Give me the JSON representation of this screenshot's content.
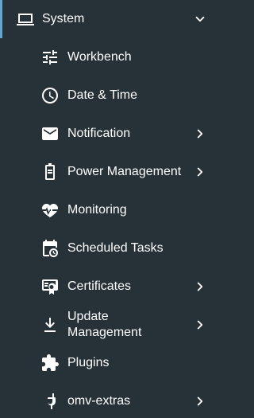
{
  "nav": {
    "system": {
      "label": "System",
      "icon": "laptop-icon",
      "expanded": true
    },
    "items": [
      {
        "label": "Workbench",
        "icon": "tune-icon",
        "has_submenu": false
      },
      {
        "label": "Date & Time",
        "icon": "clock-icon",
        "has_submenu": false
      },
      {
        "label": "Notification",
        "icon": "mail-icon",
        "has_submenu": true
      },
      {
        "label": "Power Management",
        "icon": "battery-icon",
        "has_submenu": true
      },
      {
        "label": "Monitoring",
        "icon": "heart-pulse-icon",
        "has_submenu": false
      },
      {
        "label": "Scheduled Tasks",
        "icon": "calendar-clock-icon",
        "has_submenu": false
      },
      {
        "label": "Certificates",
        "icon": "certificate-icon",
        "has_submenu": true
      },
      {
        "label": "Update Management",
        "icon": "download-icon",
        "has_submenu": true
      },
      {
        "label": "Plugins",
        "icon": "puzzle-icon",
        "has_submenu": false
      },
      {
        "label": "omv-extras",
        "icon": "power-plug-icon",
        "has_submenu": true
      }
    ]
  },
  "colors": {
    "background": "#263238",
    "accent": "#5aa9d6",
    "text": "#ffffff"
  }
}
